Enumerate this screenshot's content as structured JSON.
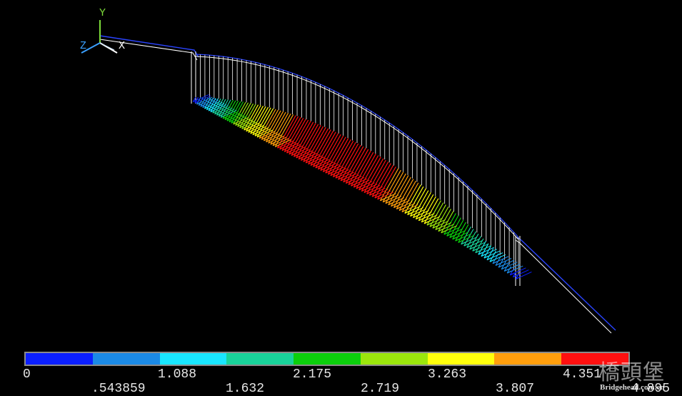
{
  "triad": {
    "y_label": "Y",
    "x_label": "X",
    "z_label": "Z",
    "y_color": "#7ddc3a",
    "x_color": "#ffffff",
    "z_color": "#3aa0ff"
  },
  "model": {
    "frame_color": "#ffffff",
    "cable_color": "#2a44ff"
  },
  "legend": {
    "colors": [
      "#0b1fff",
      "#1b8ae6",
      "#19e6ff",
      "#19d39a",
      "#0ccf0c",
      "#9be60c",
      "#ffff0c",
      "#ff9e0c",
      "#ff1010"
    ],
    "top_ticks": [
      "0",
      "1.088",
      "2.175",
      "3.263",
      "4.351"
    ],
    "bottom_ticks": [
      ".543859",
      "1.632",
      "2.719",
      "3.807",
      "4.895"
    ]
  },
  "watermark": {
    "logo_text": "橋頭堡",
    "url": "Bridgehead.com.cn"
  }
}
